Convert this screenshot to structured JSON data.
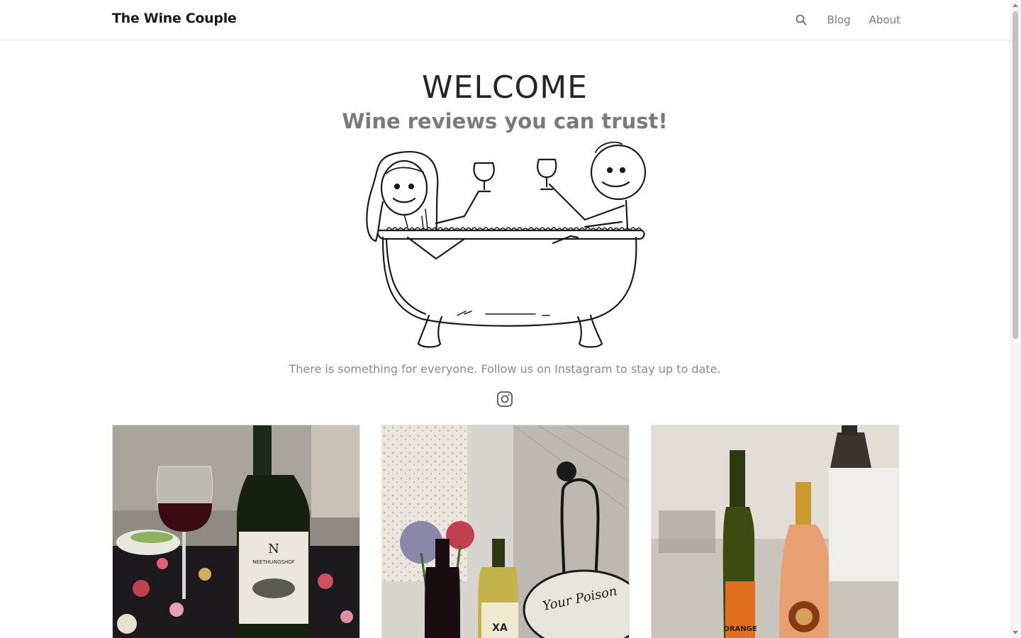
{
  "navbar": {
    "brand": "The Wine Couple",
    "links": [
      "Blog",
      "About"
    ],
    "search_icon": "search-icon"
  },
  "hero": {
    "title": "WELCOME",
    "subtitle": "Wine reviews you can trust!",
    "illustration": "couple-in-bathtub-with-wine",
    "text": "There is something for everyone. Follow us on Instagram to stay up to date.",
    "social_icon": "instagram-icon"
  },
  "cards": [
    {
      "image": "red-wine-glass-and-bottle-on-floral-tablecloth"
    },
    {
      "image": "wine-bottles-with-flowers-and-halloween-decor"
    },
    {
      "image": "white-and-rose-wine-bottles"
    }
  ],
  "colors": {
    "text_dark": "#262626",
    "text_muted": "#7a7a7a",
    "border": "#e6e6e6"
  }
}
